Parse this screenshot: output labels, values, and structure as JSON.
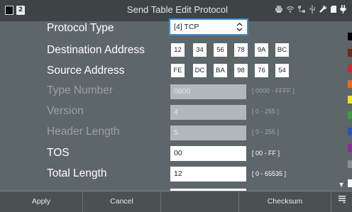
{
  "window": {
    "title": "Send Table Edit Protocol",
    "badge": "2"
  },
  "status_icons": [
    "print-icon",
    "wifi-icon",
    "network-icon",
    "usb-icon",
    "tool-icon",
    "sdcard-icon",
    "power-icon"
  ],
  "form": {
    "protocol_type": {
      "label": "Protocol Type",
      "value": "[4] TCP"
    },
    "destination_address": {
      "label": "Destination Address",
      "bytes": [
        "12",
        "34",
        "56",
        "78",
        "9A",
        "BC"
      ]
    },
    "source_address": {
      "label": "Source Address",
      "bytes": [
        "FE",
        "DC",
        "BA",
        "98",
        "76",
        "54"
      ]
    },
    "type_number": {
      "label": "Type Number",
      "value": "0800",
      "range": "[ 0000 - FFFF ]",
      "enabled": false
    },
    "version": {
      "label": "Version",
      "value": "4",
      "range": "[ 0 - 255 ]",
      "enabled": false
    },
    "header_length": {
      "label": "Header Length",
      "value": "5",
      "range": "[ 0 - 255 ]",
      "enabled": false
    },
    "tos": {
      "label": "TOS",
      "value": "00",
      "range": "[ 00 - FF ]",
      "enabled": true
    },
    "total_length": {
      "label": "Total Length",
      "value": "12",
      "range": "[ 0 - 65535 ]",
      "enabled": true
    }
  },
  "color_strip": [
    "#000000",
    "#6b2a1a",
    "#d7222b",
    "#e86a1c",
    "#f4e21b",
    "#3aa03a",
    "#2357b8",
    "#8a2aa0",
    "#8a8f91",
    "#ffffff"
  ],
  "bottom_bar": {
    "apply": "Apply",
    "cancel": "Cancel",
    "empty": "",
    "checksum": "Checksum"
  }
}
